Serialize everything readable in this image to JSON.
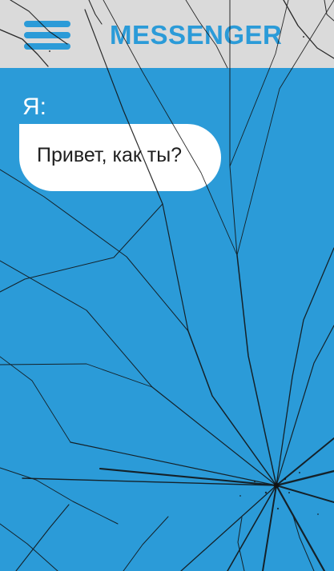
{
  "header": {
    "title": "MESSENGER",
    "menu_icon": "hamburger-menu-icon"
  },
  "chat": {
    "messages": [
      {
        "sender": "Я:",
        "text": "Привет, как ты?"
      }
    ]
  },
  "colors": {
    "header_background": "#dadada",
    "accent": "#2b9bd8",
    "chat_background": "#2b9bd8",
    "bubble_background": "#ffffff",
    "bubble_text": "#202020",
    "crack_overlay": "#111111"
  }
}
